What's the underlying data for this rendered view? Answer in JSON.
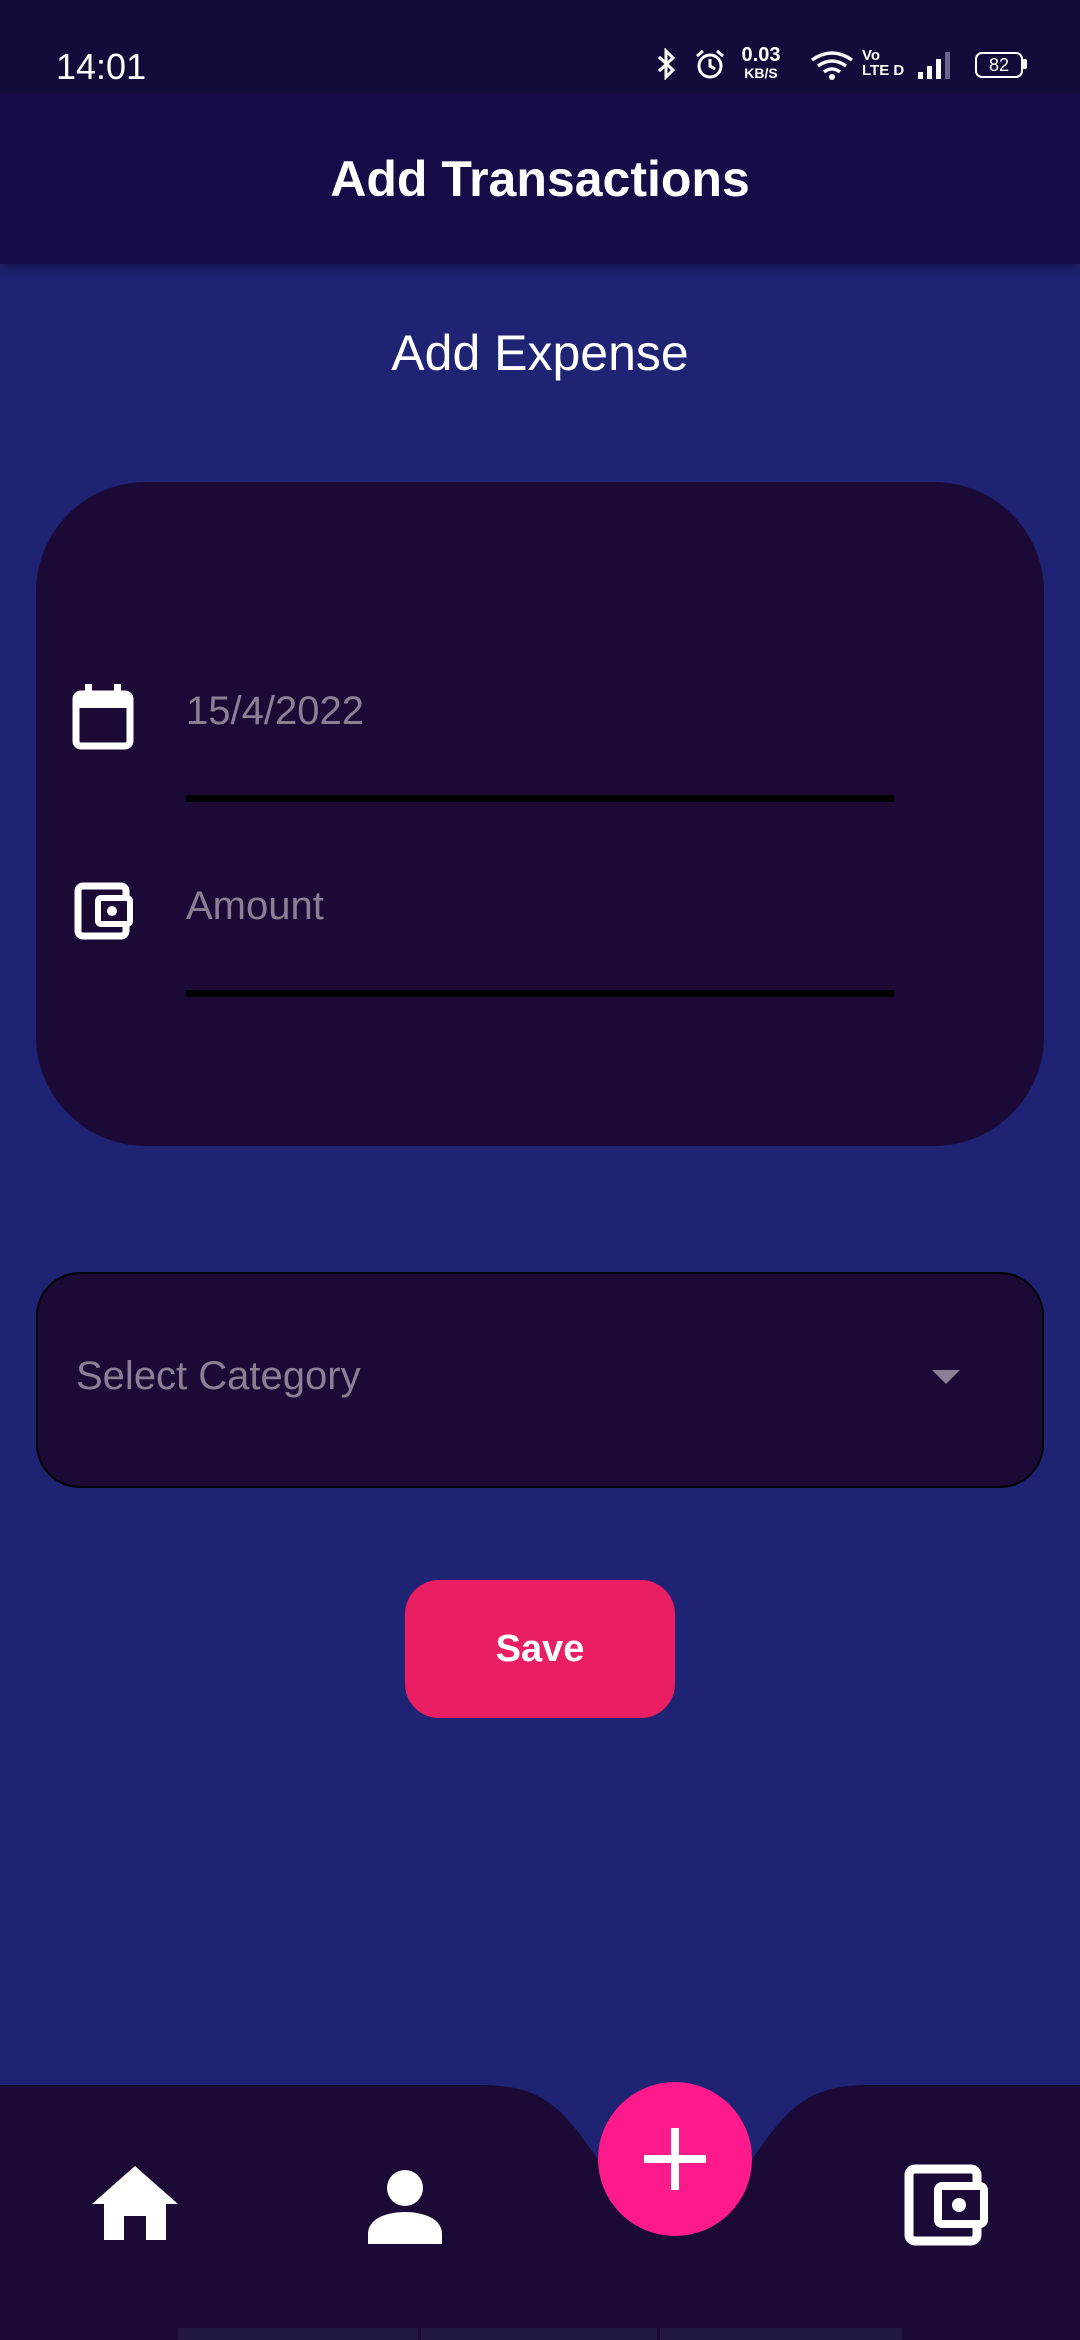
{
  "status_bar": {
    "time": "14:01",
    "net_speed_value": "0.03",
    "net_speed_unit": "KB/S",
    "volte_line1": "Vo",
    "volte_line2": "LTE D",
    "battery": "82"
  },
  "app_bar": {
    "title": "Add Transactions"
  },
  "page": {
    "heading": "Add Expense"
  },
  "form": {
    "date_value": "15/4/2022",
    "amount_placeholder": "Amount"
  },
  "category": {
    "placeholder": "Select Category"
  },
  "save_label": "Save",
  "icons": {
    "date": "calendar-icon",
    "amount": "wallet-icon",
    "dropdown": "caret-down-icon",
    "nav_home": "home-icon",
    "nav_profile": "person-icon",
    "nav_add": "plus-icon",
    "nav_wallet": "wallet-icon"
  },
  "colors": {
    "background": "#1e2373",
    "app_bar": "#170b48",
    "card": "#1a0a35",
    "save_button": "#e91e63",
    "fab": "#ff1a8c"
  }
}
